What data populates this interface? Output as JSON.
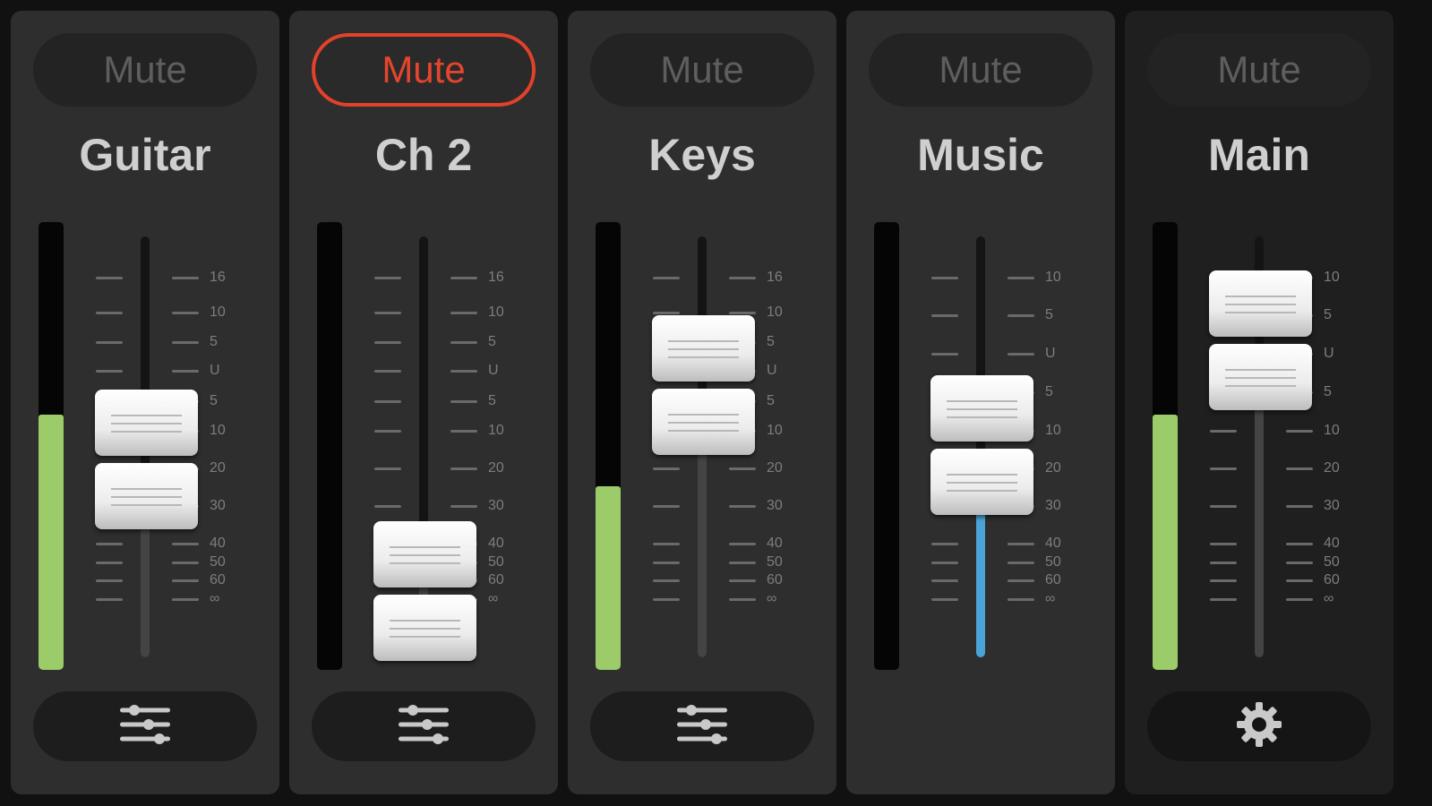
{
  "colors": {
    "accent_mute": "#e5452d",
    "meter_green": "#9ccb6a",
    "fader_blue": "#4aa3d8",
    "strip_bg": "#2e2e2e",
    "main_strip_bg": "#1f1f1f"
  },
  "channels": [
    {
      "name": "Guitar",
      "mute_label": "Mute",
      "muted": false,
      "scale": [
        "16",
        "10",
        "5",
        "U",
        "5",
        "10",
        "20",
        "30",
        "40",
        "50",
        "60",
        "∞"
      ],
      "fader_level": "10",
      "meter_fraction": 0.57,
      "bottom_button": "sliders-icon"
    },
    {
      "name": "Ch 2",
      "mute_label": "Mute",
      "muted": true,
      "scale": [
        "16",
        "10",
        "5",
        "U",
        "5",
        "10",
        "20",
        "30",
        "40",
        "50",
        "60",
        "∞"
      ],
      "fader_level": "40",
      "meter_fraction": 0,
      "bottom_button": "sliders-icon"
    },
    {
      "name": "Keys",
      "mute_label": "Mute",
      "muted": false,
      "scale": [
        "16",
        "10",
        "5",
        "U",
        "5",
        "10",
        "20",
        "30",
        "40",
        "50",
        "60",
        "∞"
      ],
      "fader_level": "5",
      "meter_fraction": 0.41,
      "bottom_button": "sliders-icon"
    },
    {
      "name": "Music",
      "mute_label": "Mute",
      "muted": false,
      "scale": [
        "10",
        "5",
        "U",
        "5",
        "10",
        "20",
        "30",
        "40",
        "50",
        "60",
        "∞"
      ],
      "fader_level": "5",
      "meter_fraction": 0,
      "fader_highlight": "blue"
    },
    {
      "name": "Main",
      "mute_label": "Mute",
      "muted": false,
      "scale": [
        "10",
        "5",
        "U",
        "5",
        "10",
        "20",
        "30",
        "40",
        "50",
        "60",
        "∞"
      ],
      "fader_level": "10",
      "meter_fraction": 0.57,
      "bottom_button": "gear-icon"
    }
  ]
}
